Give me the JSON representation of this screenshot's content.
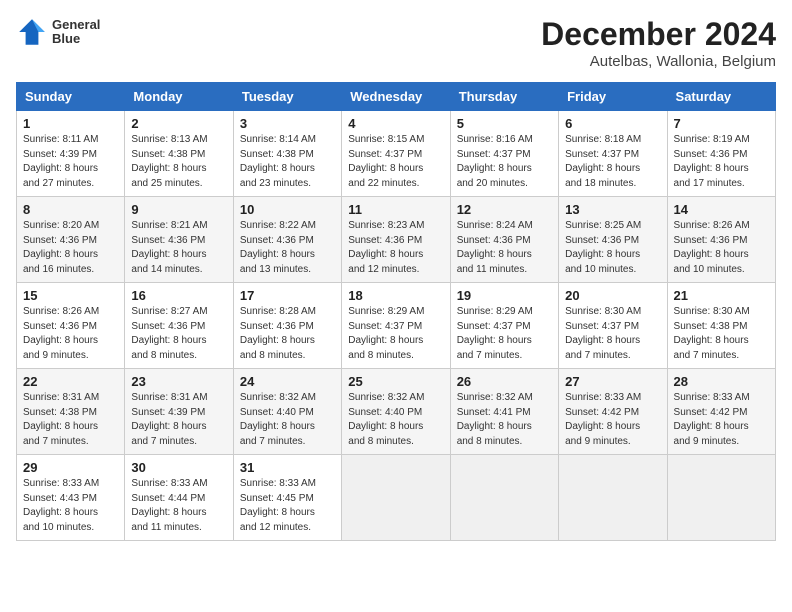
{
  "header": {
    "logo_line1": "General",
    "logo_line2": "Blue",
    "month": "December 2024",
    "location": "Autelbas, Wallonia, Belgium"
  },
  "weekdays": [
    "Sunday",
    "Monday",
    "Tuesday",
    "Wednesday",
    "Thursday",
    "Friday",
    "Saturday"
  ],
  "weeks": [
    [
      {
        "day": "1",
        "sunrise": "8:11 AM",
        "sunset": "4:39 PM",
        "daylight": "8 hours and 27 minutes."
      },
      {
        "day": "2",
        "sunrise": "8:13 AM",
        "sunset": "4:38 PM",
        "daylight": "8 hours and 25 minutes."
      },
      {
        "day": "3",
        "sunrise": "8:14 AM",
        "sunset": "4:38 PM",
        "daylight": "8 hours and 23 minutes."
      },
      {
        "day": "4",
        "sunrise": "8:15 AM",
        "sunset": "4:37 PM",
        "daylight": "8 hours and 22 minutes."
      },
      {
        "day": "5",
        "sunrise": "8:16 AM",
        "sunset": "4:37 PM",
        "daylight": "8 hours and 20 minutes."
      },
      {
        "day": "6",
        "sunrise": "8:18 AM",
        "sunset": "4:37 PM",
        "daylight": "8 hours and 18 minutes."
      },
      {
        "day": "7",
        "sunrise": "8:19 AM",
        "sunset": "4:36 PM",
        "daylight": "8 hours and 17 minutes."
      }
    ],
    [
      {
        "day": "8",
        "sunrise": "8:20 AM",
        "sunset": "4:36 PM",
        "daylight": "8 hours and 16 minutes."
      },
      {
        "day": "9",
        "sunrise": "8:21 AM",
        "sunset": "4:36 PM",
        "daylight": "8 hours and 14 minutes."
      },
      {
        "day": "10",
        "sunrise": "8:22 AM",
        "sunset": "4:36 PM",
        "daylight": "8 hours and 13 minutes."
      },
      {
        "day": "11",
        "sunrise": "8:23 AM",
        "sunset": "4:36 PM",
        "daylight": "8 hours and 12 minutes."
      },
      {
        "day": "12",
        "sunrise": "8:24 AM",
        "sunset": "4:36 PM",
        "daylight": "8 hours and 11 minutes."
      },
      {
        "day": "13",
        "sunrise": "8:25 AM",
        "sunset": "4:36 PM",
        "daylight": "8 hours and 10 minutes."
      },
      {
        "day": "14",
        "sunrise": "8:26 AM",
        "sunset": "4:36 PM",
        "daylight": "8 hours and 10 minutes."
      }
    ],
    [
      {
        "day": "15",
        "sunrise": "8:26 AM",
        "sunset": "4:36 PM",
        "daylight": "8 hours and 9 minutes."
      },
      {
        "day": "16",
        "sunrise": "8:27 AM",
        "sunset": "4:36 PM",
        "daylight": "8 hours and 8 minutes."
      },
      {
        "day": "17",
        "sunrise": "8:28 AM",
        "sunset": "4:36 PM",
        "daylight": "8 hours and 8 minutes."
      },
      {
        "day": "18",
        "sunrise": "8:29 AM",
        "sunset": "4:37 PM",
        "daylight": "8 hours and 8 minutes."
      },
      {
        "day": "19",
        "sunrise": "8:29 AM",
        "sunset": "4:37 PM",
        "daylight": "8 hours and 7 minutes."
      },
      {
        "day": "20",
        "sunrise": "8:30 AM",
        "sunset": "4:37 PM",
        "daylight": "8 hours and 7 minutes."
      },
      {
        "day": "21",
        "sunrise": "8:30 AM",
        "sunset": "4:38 PM",
        "daylight": "8 hours and 7 minutes."
      }
    ],
    [
      {
        "day": "22",
        "sunrise": "8:31 AM",
        "sunset": "4:38 PM",
        "daylight": "8 hours and 7 minutes."
      },
      {
        "day": "23",
        "sunrise": "8:31 AM",
        "sunset": "4:39 PM",
        "daylight": "8 hours and 7 minutes."
      },
      {
        "day": "24",
        "sunrise": "8:32 AM",
        "sunset": "4:40 PM",
        "daylight": "8 hours and 7 minutes."
      },
      {
        "day": "25",
        "sunrise": "8:32 AM",
        "sunset": "4:40 PM",
        "daylight": "8 hours and 8 minutes."
      },
      {
        "day": "26",
        "sunrise": "8:32 AM",
        "sunset": "4:41 PM",
        "daylight": "8 hours and 8 minutes."
      },
      {
        "day": "27",
        "sunrise": "8:33 AM",
        "sunset": "4:42 PM",
        "daylight": "8 hours and 9 minutes."
      },
      {
        "day": "28",
        "sunrise": "8:33 AM",
        "sunset": "4:42 PM",
        "daylight": "8 hours and 9 minutes."
      }
    ],
    [
      {
        "day": "29",
        "sunrise": "8:33 AM",
        "sunset": "4:43 PM",
        "daylight": "8 hours and 10 minutes."
      },
      {
        "day": "30",
        "sunrise": "8:33 AM",
        "sunset": "4:44 PM",
        "daylight": "8 hours and 11 minutes."
      },
      {
        "day": "31",
        "sunrise": "8:33 AM",
        "sunset": "4:45 PM",
        "daylight": "8 hours and 12 minutes."
      },
      null,
      null,
      null,
      null
    ]
  ],
  "labels": {
    "sunrise": "Sunrise:",
    "sunset": "Sunset:",
    "daylight": "Daylight hours"
  }
}
